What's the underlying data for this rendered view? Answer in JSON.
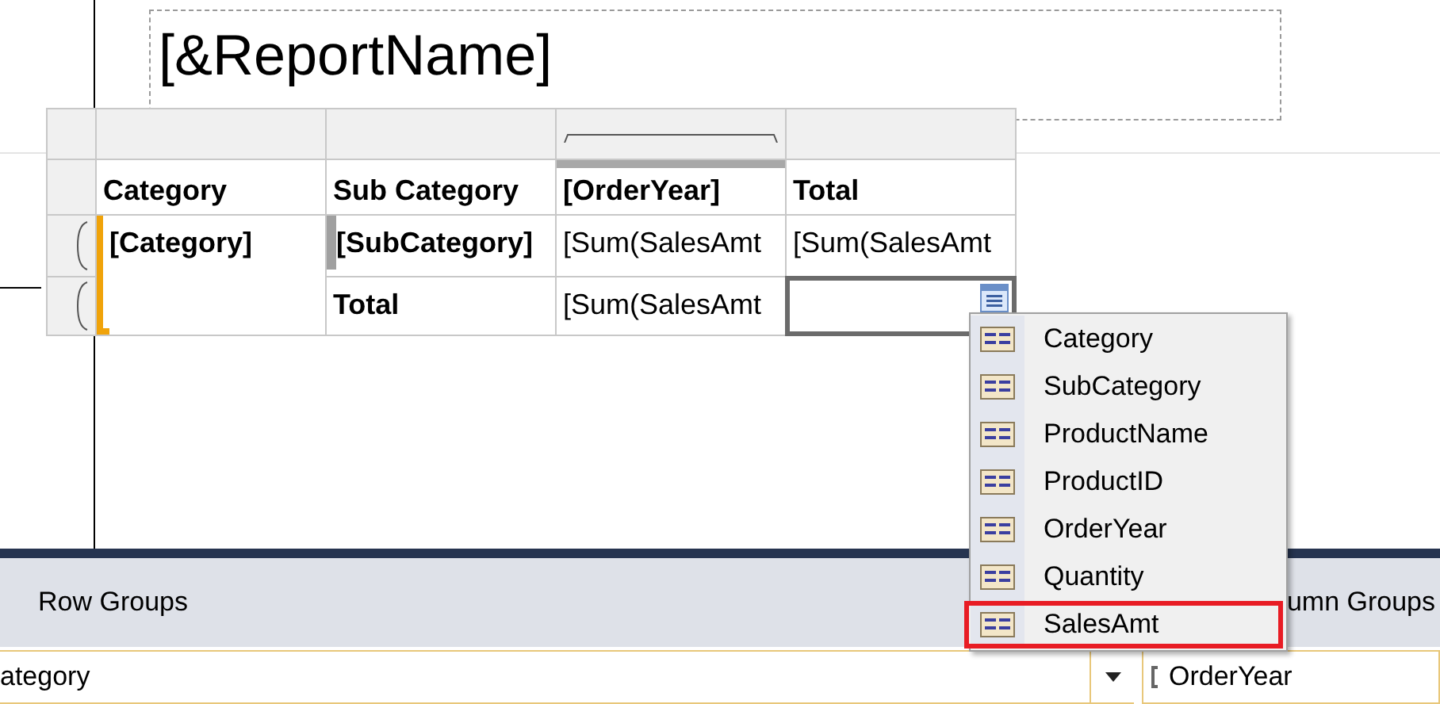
{
  "report": {
    "title": "[&ReportName]"
  },
  "tablix": {
    "header": [
      {
        "text": "Category"
      },
      {
        "text": "Sub Category"
      },
      {
        "text": "[OrderYear]"
      },
      {
        "text": "Total"
      }
    ],
    "rows": [
      {
        "cells": [
          {
            "kind": "group",
            "text": "[Category]",
            "bold": true,
            "selected": false
          },
          {
            "kind": "inner_group",
            "text": "[SubCategory]",
            "bold": true,
            "selected": false
          },
          {
            "kind": "text",
            "text": "[Sum(SalesAmt",
            "bold": false,
            "selected": false
          },
          {
            "kind": "text",
            "text": "[Sum(SalesAmt",
            "bold": false,
            "selected": false
          }
        ]
      },
      {
        "cells": [
          {
            "kind": "spanned"
          },
          {
            "kind": "text",
            "text": "Total",
            "bold": true,
            "selected": false
          },
          {
            "kind": "text",
            "text": "[Sum(SalesAmt",
            "bold": false,
            "selected": false
          },
          {
            "kind": "field_picker",
            "selected": true
          }
        ]
      }
    ]
  },
  "field_menu": {
    "items": [
      {
        "label": "Category",
        "selected": false
      },
      {
        "label": "SubCategory",
        "selected": false
      },
      {
        "label": "ProductName",
        "selected": false
      },
      {
        "label": "ProductID",
        "selected": false
      },
      {
        "label": "OrderYear",
        "selected": false
      },
      {
        "label": "Quantity",
        "selected": false
      },
      {
        "label": "SalesAmt",
        "selected": true
      }
    ]
  },
  "row_groups": {
    "title": "Row Groups",
    "group": "ategory"
  },
  "column_groups": {
    "title": "umn Groups",
    "group": "OrderYear"
  }
}
